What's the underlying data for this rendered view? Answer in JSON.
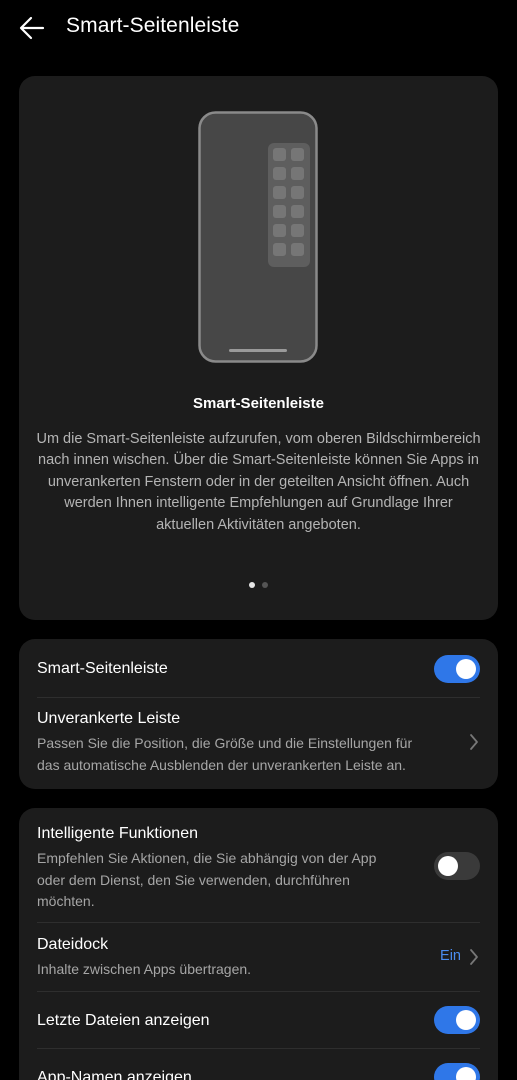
{
  "header": {
    "title": "Smart-Seitenleiste",
    "back_icon": "arrow-left-icon"
  },
  "hero": {
    "title": "Smart-Seitenleiste",
    "description": "Um die Smart-Seitenleiste aufzurufen, vom oberen Bildschirmbereich nach innen wischen. Über die Smart-Seitenleiste können Sie Apps in unverankerten Fenstern oder in der geteilten Ansicht öffnen. Auch werden Ihnen intelligente Empfehlungen auf Grundlage Ihrer aktuellen Aktivitäten angeboten.",
    "pages_total": 2,
    "page_active": 1
  },
  "group1": {
    "smart_sidebar": {
      "label": "Smart-Seitenleiste",
      "enabled": true
    },
    "floating_bar": {
      "label": "Unverankerte Leiste",
      "description": "Passen Sie die Position, die Größe und die Einstellungen für das automatische Ausblenden der unverankerten Leiste an."
    }
  },
  "group2": {
    "smart_functions": {
      "label": "Intelligente Funktionen",
      "description": "Empfehlen Sie Aktionen, die Sie abhängig von der App oder dem Dienst, den Sie verwenden, durchführen möchten.",
      "enabled": false
    },
    "file_dock": {
      "label": "Dateidock",
      "description": "Inhalte zwischen Apps übertragen.",
      "value": "Ein"
    },
    "recent_files": {
      "label": "Letzte Dateien anzeigen",
      "enabled": true
    },
    "app_names": {
      "label": "App-Namen anzeigen",
      "enabled": true
    }
  },
  "colors": {
    "background": "#000000",
    "card": "#1c1c1c",
    "accent": "#2f77e8",
    "value_text": "#4a8cf0"
  }
}
